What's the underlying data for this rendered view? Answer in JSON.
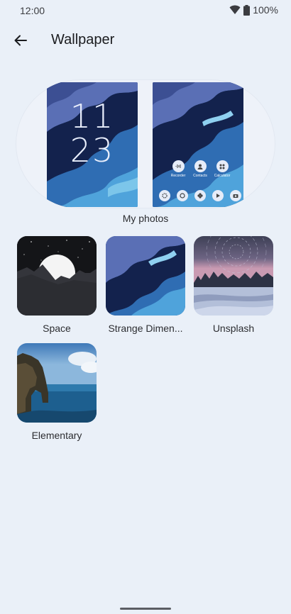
{
  "status": {
    "time": "12:00",
    "battery": "100%",
    "icons": [
      "wifi-icon",
      "battery-icon"
    ]
  },
  "header": {
    "title": "Wallpaper",
    "back_icon": "arrow-back-icon"
  },
  "preview": {
    "lock_clock_hour": "11",
    "lock_clock_minute": "23",
    "apps": [
      "Recorder",
      "Contacts",
      "Calculator"
    ],
    "label": "My photos"
  },
  "categories": [
    {
      "label": "Space"
    },
    {
      "label": "Strange Dimen..."
    },
    {
      "label": "Unsplash"
    },
    {
      "label": "Elementary"
    }
  ],
  "colors": {
    "background": "#eaf0f8",
    "text": "#1b1c1f"
  }
}
